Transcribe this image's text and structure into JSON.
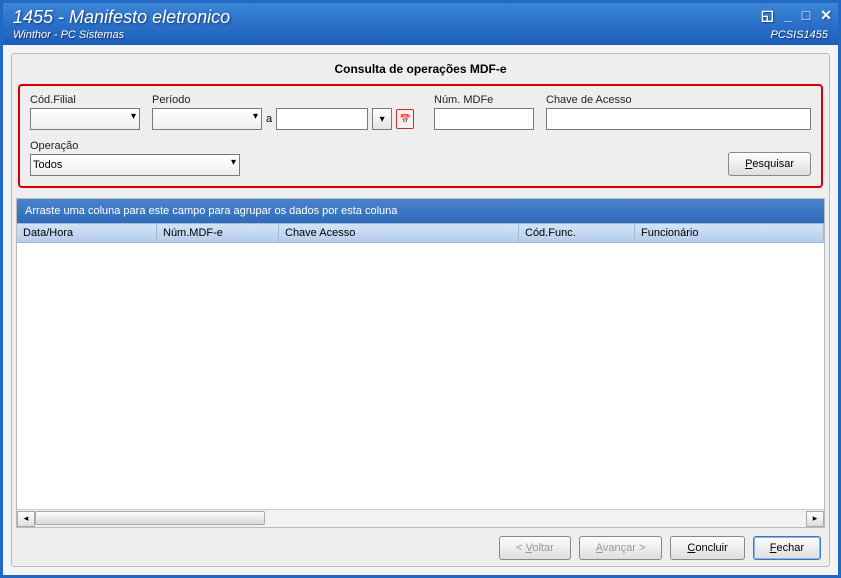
{
  "window": {
    "title": "1455 - Manifesto eletronico",
    "subtitle": "Winthor - PC Sistemas",
    "code": "PCSIS1455"
  },
  "panel": {
    "title": "Consulta de operações MDF-e"
  },
  "filters": {
    "cod_filial_label": "Cód.Filial",
    "periodo_label": "Período",
    "periodo_sep": "a",
    "num_mdfe_label": "Núm. MDFe",
    "chave_label": "Chave de Acesso",
    "operacao_label": "Operação",
    "operacao_value": "Todos",
    "pesquisar_label": "Pesquisar",
    "pesquisar_uchar": "P"
  },
  "grid": {
    "group_hint": "Arraste uma coluna para este campo para agrupar os dados por esta coluna",
    "cols": {
      "datahora": "Data/Hora",
      "nummdf": "Núm.MDF-e",
      "chave": "Chave Acesso",
      "codfunc": "Cód.Func.",
      "func": "Funcionário"
    }
  },
  "footer": {
    "voltar": "Voltar",
    "avancar": "Avançar",
    "concluir": "Concluir",
    "fechar": "Fechar"
  }
}
